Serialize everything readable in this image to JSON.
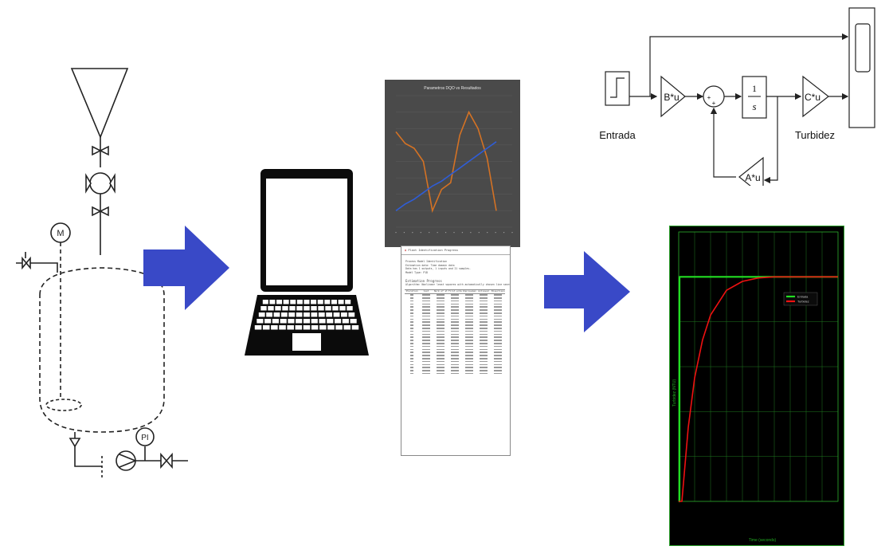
{
  "colors": {
    "arrow": "#3949c7",
    "plot_bg": "#000000",
    "plot_grid": "#1f7a1f",
    "entrada_trace": "#22dd22",
    "turbidez_trace": "#ee1111",
    "orange_series": "#d47224",
    "blue_series": "#2f5dd6",
    "report_header": "#c62828"
  },
  "process_diagram": {
    "motor_label": "M",
    "indicator_label": "PI"
  },
  "laptop": {
    "icon": "laptop-icon"
  },
  "orange_chart": {
    "title": "Parametros DQO vs Resultados"
  },
  "report": {
    "title": "Plant Identification Progress",
    "lines": [
      "Process Model Identification",
      "",
      "Estimation data: Time domain data",
      "Data has 1 outputs, 1 inputs and 21 samples.",
      "Model Type: P1D"
    ],
    "progress_title": "Estimation Progress",
    "algorithm": "Algorithm: Nonlinear least squares with automatically chosen line search method",
    "columns": [
      "Iteration",
      "Cost",
      "Norm of step",
      "First-order optimality",
      "Improvement (%) Expected",
      "Achieved",
      "Bisections"
    ]
  },
  "block_diagram": {
    "gain_b": "B*u",
    "gain_c": "C*u",
    "gain_a": "A*u",
    "integrator_num": "1",
    "integrator_den": "s",
    "sum_plus_left": "+",
    "sum_plus_bottom": "+",
    "input_label": "Entrada",
    "output_label": "Turbidez"
  },
  "response_plot": {
    "legend_entrada": "Entrada",
    "legend_turbidez": "Turbidez",
    "xlabel": "Time (seconds)",
    "ylabel": "Turbidez (NTU)"
  },
  "chart_data": [
    {
      "type": "line",
      "title": "Parametros DQO vs Resultados",
      "x": [
        1,
        2,
        3,
        4,
        5,
        6,
        7,
        8,
        9,
        10,
        11,
        12,
        13,
        14,
        15
      ],
      "series": [
        {
          "values": [
            58,
            51,
            48,
            40,
            10,
            23,
            27,
            56,
            70,
            60,
            42,
            10
          ]
        },
        {
          "values": [
            10,
            14,
            17,
            21,
            25,
            28,
            32,
            36,
            40,
            44,
            48,
            52
          ]
        }
      ],
      "ylim": [
        0,
        80
      ],
      "grid": true
    },
    {
      "type": "line",
      "xlabel": "Time (seconds)",
      "ylabel": "Turbidez (NTU)",
      "xlim": [
        0,
        10
      ],
      "ylim": [
        0,
        1.2
      ],
      "grid": true,
      "legend": "top-right",
      "series": [
        {
          "name": "Entrada",
          "x": [
            0,
            0.05,
            0.05,
            10
          ],
          "values": [
            0,
            0,
            1,
            1
          ]
        },
        {
          "name": "Turbidez",
          "x": [
            0,
            0.2,
            0.6,
            1,
            1.5,
            2,
            3,
            4,
            5,
            6,
            8,
            10
          ],
          "values": [
            0,
            0,
            0.33,
            0.55,
            0.72,
            0.83,
            0.94,
            0.98,
            0.995,
            1,
            1,
            1
          ]
        }
      ]
    }
  ]
}
